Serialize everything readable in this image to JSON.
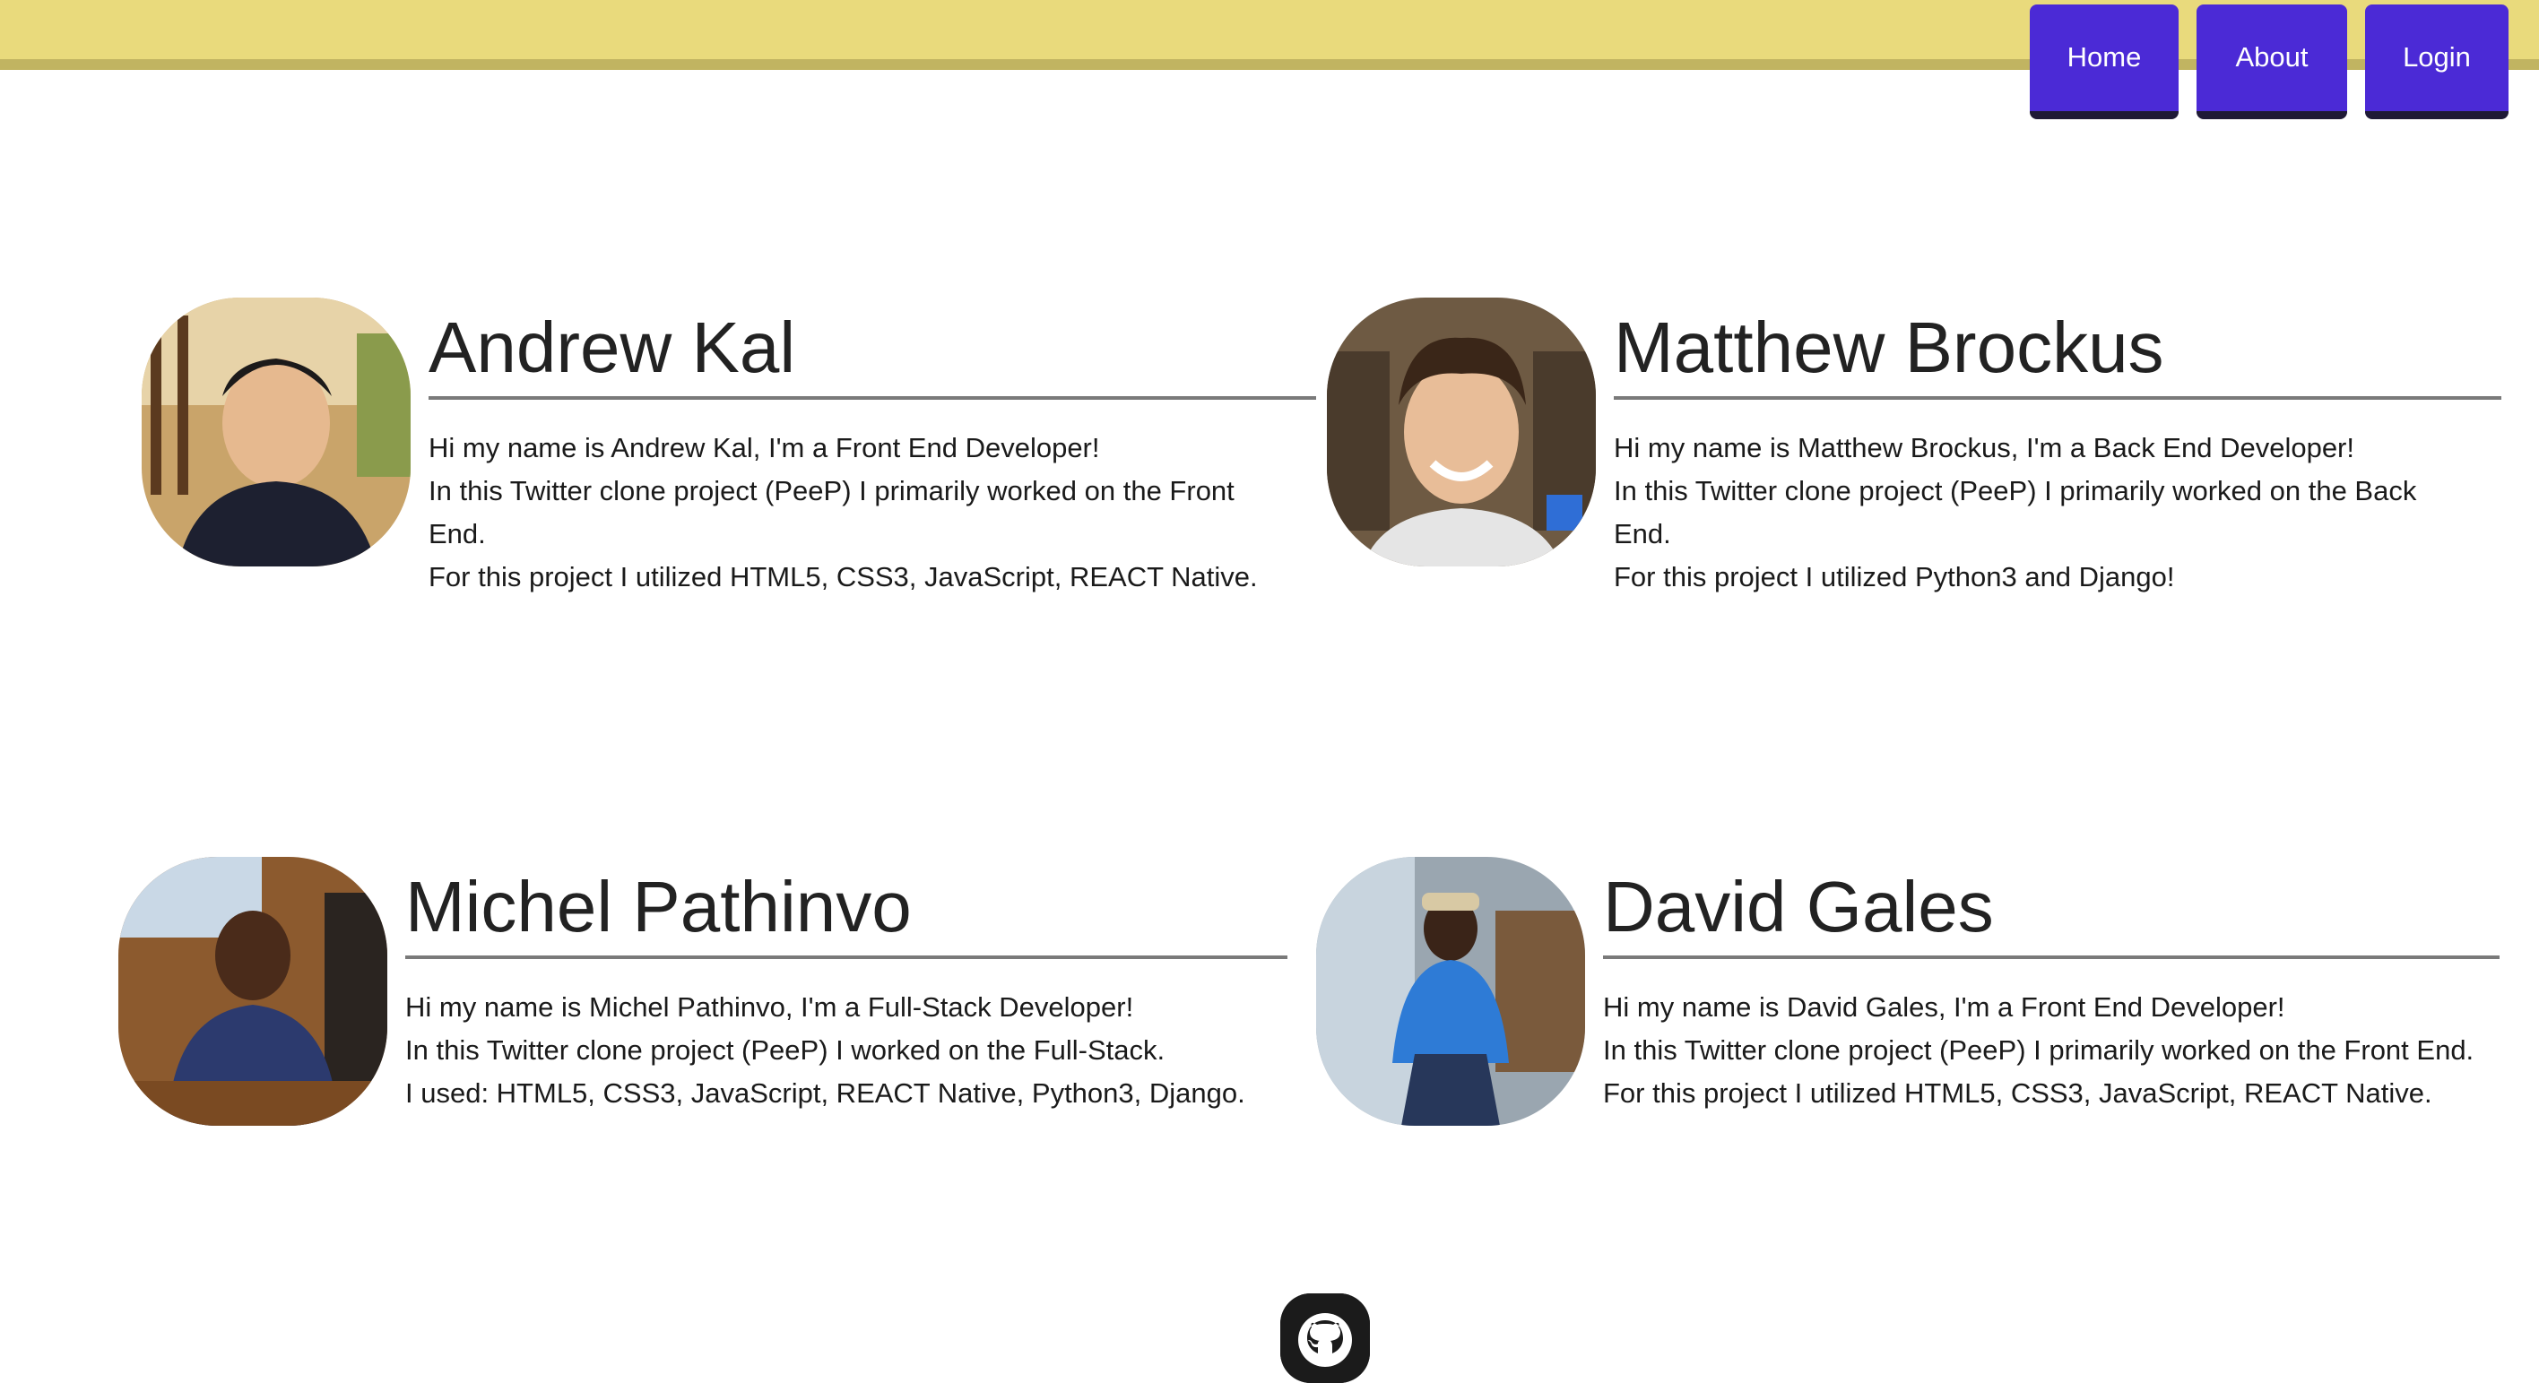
{
  "nav": {
    "home_label": "Home",
    "about_label": "About",
    "login_label": "Login"
  },
  "colors": {
    "topbar": "#e9da7c",
    "topbar_border": "#c1b461",
    "nav_button": "#4b2ad6",
    "divider": "#7a7a7a"
  },
  "team": [
    {
      "name": "Andrew Kal",
      "bio": [
        "Hi my name is Andrew Kal, I'm a Front End Developer!",
        "In this Twitter clone project (PeeP) I primarily worked on the Front",
        "End.",
        "For this project I utilized HTML5, CSS3, JavaScript, REACT Native."
      ]
    },
    {
      "name": "Matthew Brockus",
      "bio": [
        "Hi my name is Matthew Brockus, I'm a Back End Developer!",
        "In this Twitter clone project (PeeP) I primarily worked on the Back",
        "End.",
        "For this project I utilized Python3 and Django!"
      ]
    },
    {
      "name": "Michel Pathinvo",
      "bio": [
        "Hi my name is Michel Pathinvo, I'm a Full-Stack Developer!",
        "In this Twitter clone project (PeeP) I worked on the Full-Stack.",
        "I used: HTML5, CSS3, JavaScript, REACT Native, Python3, Django."
      ]
    },
    {
      "name": "David Gales",
      "bio": [
        "Hi my name is David Gales, I'm a Front End Developer!",
        "In this Twitter clone project (PeeP) I primarily worked on the Front End.",
        "For this project I utilized HTML5, CSS3, JavaScript, REACT Native."
      ]
    }
  ],
  "footer": {
    "icon": "github-icon"
  }
}
